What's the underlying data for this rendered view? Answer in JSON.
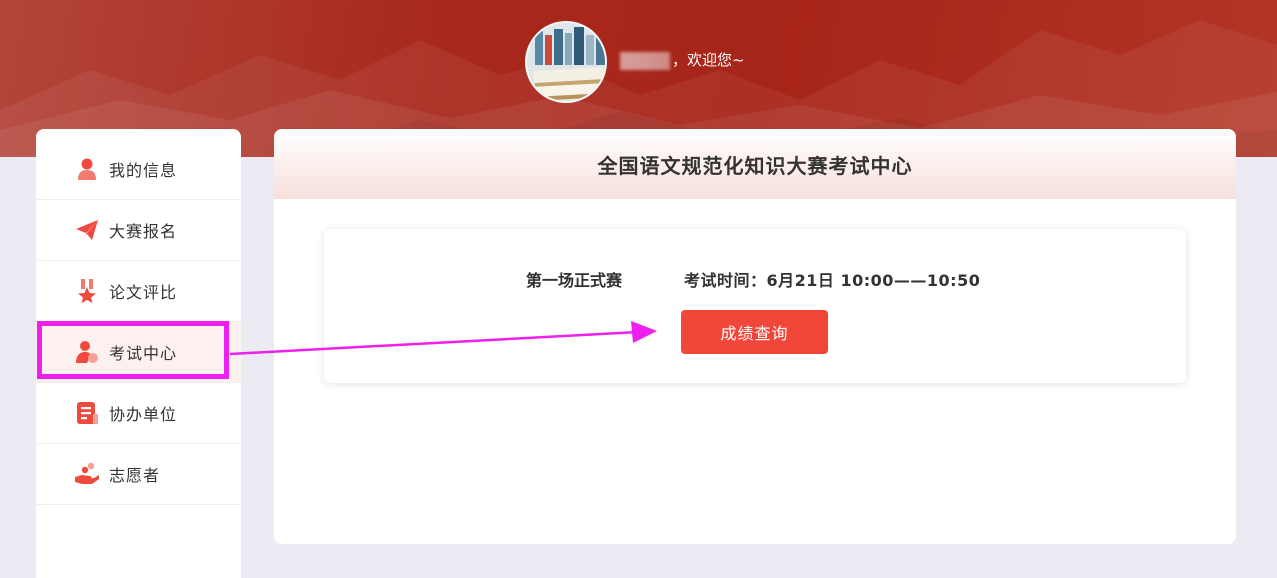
{
  "header": {
    "welcome_text": "，欢迎您~"
  },
  "sidebar": {
    "items": [
      {
        "label": "我的信息",
        "icon": "user-icon"
      },
      {
        "label": "大赛报名",
        "icon": "paper-plane-icon"
      },
      {
        "label": "论文评比",
        "icon": "medal-icon"
      },
      {
        "label": "考试中心",
        "icon": "exam-user-icon"
      },
      {
        "label": "协办单位",
        "icon": "document-list-icon"
      },
      {
        "label": "志愿者",
        "icon": "helping-hand-icon"
      }
    ],
    "active_index": 3
  },
  "main": {
    "title": "全国语文规范化知识大赛考试中心",
    "exam": {
      "name": "第一场正式赛",
      "time": "考试时间：6月21日 10:00——10:50",
      "button_label": "成绩查询"
    }
  },
  "colors": {
    "brand_red": "#a72418",
    "button_red": "#f0473a",
    "annotation_magenta": "#ee20ee",
    "icon_red": "#f04a3e"
  }
}
